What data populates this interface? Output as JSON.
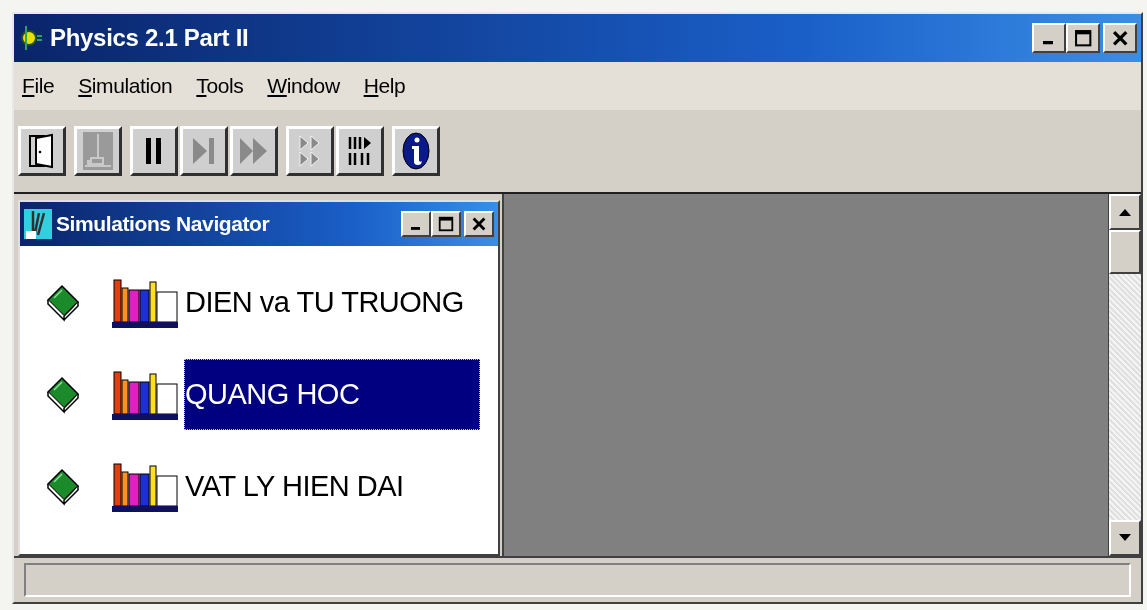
{
  "window": {
    "title": "Physics 2.1 Part II"
  },
  "menu": [
    "File",
    "Simulation",
    "Tools",
    "Window",
    "Help"
  ],
  "toolbar": [
    [
      {
        "kind": "exit",
        "disabled": false
      }
    ],
    [
      {
        "kind": "simulation",
        "disabled": true
      }
    ],
    [
      {
        "kind": "pause",
        "disabled": false
      },
      {
        "kind": "step",
        "disabled": true
      },
      {
        "kind": "fast-forward",
        "disabled": true
      }
    ],
    [
      {
        "kind": "run-steps",
        "disabled": true
      },
      {
        "kind": "step-pause",
        "disabled": false
      }
    ],
    [
      {
        "kind": "info",
        "disabled": false
      }
    ]
  ],
  "navigator": {
    "title": "Simulations Navigator",
    "items": [
      {
        "label": "DIEN va TU TRUONG",
        "selected": false
      },
      {
        "label": "QUANG HOC",
        "selected": true
      },
      {
        "label": "VAT LY HIEN DAI",
        "selected": false
      }
    ]
  }
}
